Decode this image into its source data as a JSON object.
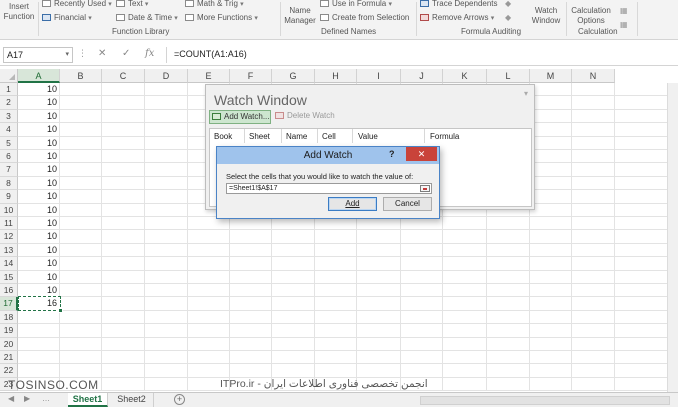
{
  "ribbon": {
    "insert_function": "Insert\nFunction",
    "recently_used": "Recently Used",
    "financial": "Financial",
    "text": "Text",
    "date_time": "Date & Time",
    "math_trig": "Math & Trig",
    "more_functions": "More Functions",
    "function_library": "Function Library",
    "name_manager": "Name\nManager",
    "use_in_formula": "Use in Formula",
    "create_from_selection": "Create from Selection",
    "defined_names": "Defined Names",
    "trace_dependents": "Trace Dependents",
    "remove_arrows": "Remove Arrows",
    "formula_auditing": "Formula Auditing",
    "watch_window": "Watch\nWindow",
    "calculation_options": "Calculation\nOptions",
    "calculation": "Calculation"
  },
  "formula_bar": {
    "name_box": "A17",
    "formula": "=COUNT(A1:A16)",
    "cancel_glyph": "✕",
    "enter_glyph": "✓",
    "fx_glyph": "fx"
  },
  "grid": {
    "columns": [
      "A",
      "B",
      "C",
      "D",
      "E",
      "F",
      "G",
      "H",
      "I",
      "J",
      "K",
      "L",
      "M",
      "N"
    ],
    "rows": [
      "1",
      "2",
      "3",
      "4",
      "5",
      "6",
      "7",
      "8",
      "9",
      "10",
      "11",
      "12",
      "13",
      "14",
      "15",
      "16",
      "17",
      "18",
      "19",
      "20",
      "21",
      "22",
      "23"
    ],
    "col_a_values": [
      "10",
      "10",
      "10",
      "10",
      "10",
      "10",
      "10",
      "10",
      "10",
      "10",
      "10",
      "10",
      "10",
      "10",
      "10",
      "10",
      "16"
    ],
    "selected_column": "A",
    "selected_row": "17"
  },
  "watch_window": {
    "title": "Watch Window",
    "add_watch": "Add Watch...",
    "delete_watch": "Delete Watch",
    "columns": [
      "Book",
      "Sheet",
      "Name",
      "Cell",
      "Value",
      "Formula"
    ]
  },
  "add_watch_dialog": {
    "title": "Add Watch",
    "help": "?",
    "close": "✕",
    "prompt": "Select the cells that you would like to watch the value of:",
    "reference": "=Sheet1!$A$17",
    "add": "Add",
    "cancel": "Cancel"
  },
  "sheet_tabs": {
    "tabs": [
      "Sheet1",
      "Sheet2"
    ],
    "active": "Sheet1",
    "add_glyph": "+"
  },
  "watermark": {
    "left": "TOSINSO.COM",
    "right": "ITPro.ir - انجمن تخصصی فناوری اطلاعات ایران"
  },
  "icons": {
    "recently_used": "star-icon",
    "financial": "money-icon",
    "text": "text-icon",
    "date_time": "calendar-icon",
    "math_trig": "math-icon",
    "more_functions": "more-functions-icon",
    "use_in_formula": "formula-icon",
    "create_from_selection": "table-icon",
    "trace_dependents": "arrow-icon",
    "remove_arrows": "remove-arrows-icon",
    "add_watch": "add-watch-icon",
    "delete_watch": "delete-icon"
  }
}
